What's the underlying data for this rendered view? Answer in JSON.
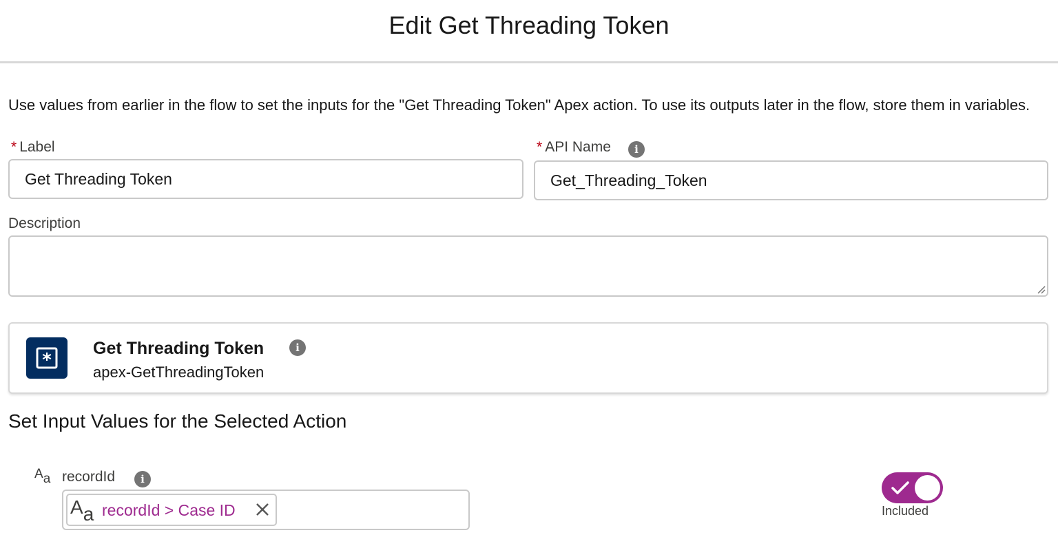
{
  "header": {
    "title": "Edit Get Threading Token"
  },
  "intro_text": "Use values from earlier in the flow to set the inputs for the \"Get Threading Token\" Apex action. To use its outputs later in the flow, store them in variables.",
  "form": {
    "required_marker": "*",
    "label_field": {
      "label": "Label",
      "value": "Get Threading Token"
    },
    "api_name_field": {
      "label": "API Name",
      "value": "Get_Threading_Token"
    },
    "description_field": {
      "label": "Description",
      "value": ""
    }
  },
  "action": {
    "title": "Get Threading Token",
    "subtitle": "apex-GetThreadingToken",
    "icon": "apex-action-icon"
  },
  "inputs_section": {
    "title": "Set Input Values for the Selected Action",
    "inputs": [
      {
        "name": "recordId",
        "type_icon": "text-type-icon",
        "pill_text": "recordId > Case ID",
        "toggle_on": true,
        "toggle_label": "Included"
      }
    ]
  },
  "colors": {
    "accent_purple": "#9e2a8f",
    "action_icon_bg": "#032d60",
    "required_red": "#ba0517"
  }
}
